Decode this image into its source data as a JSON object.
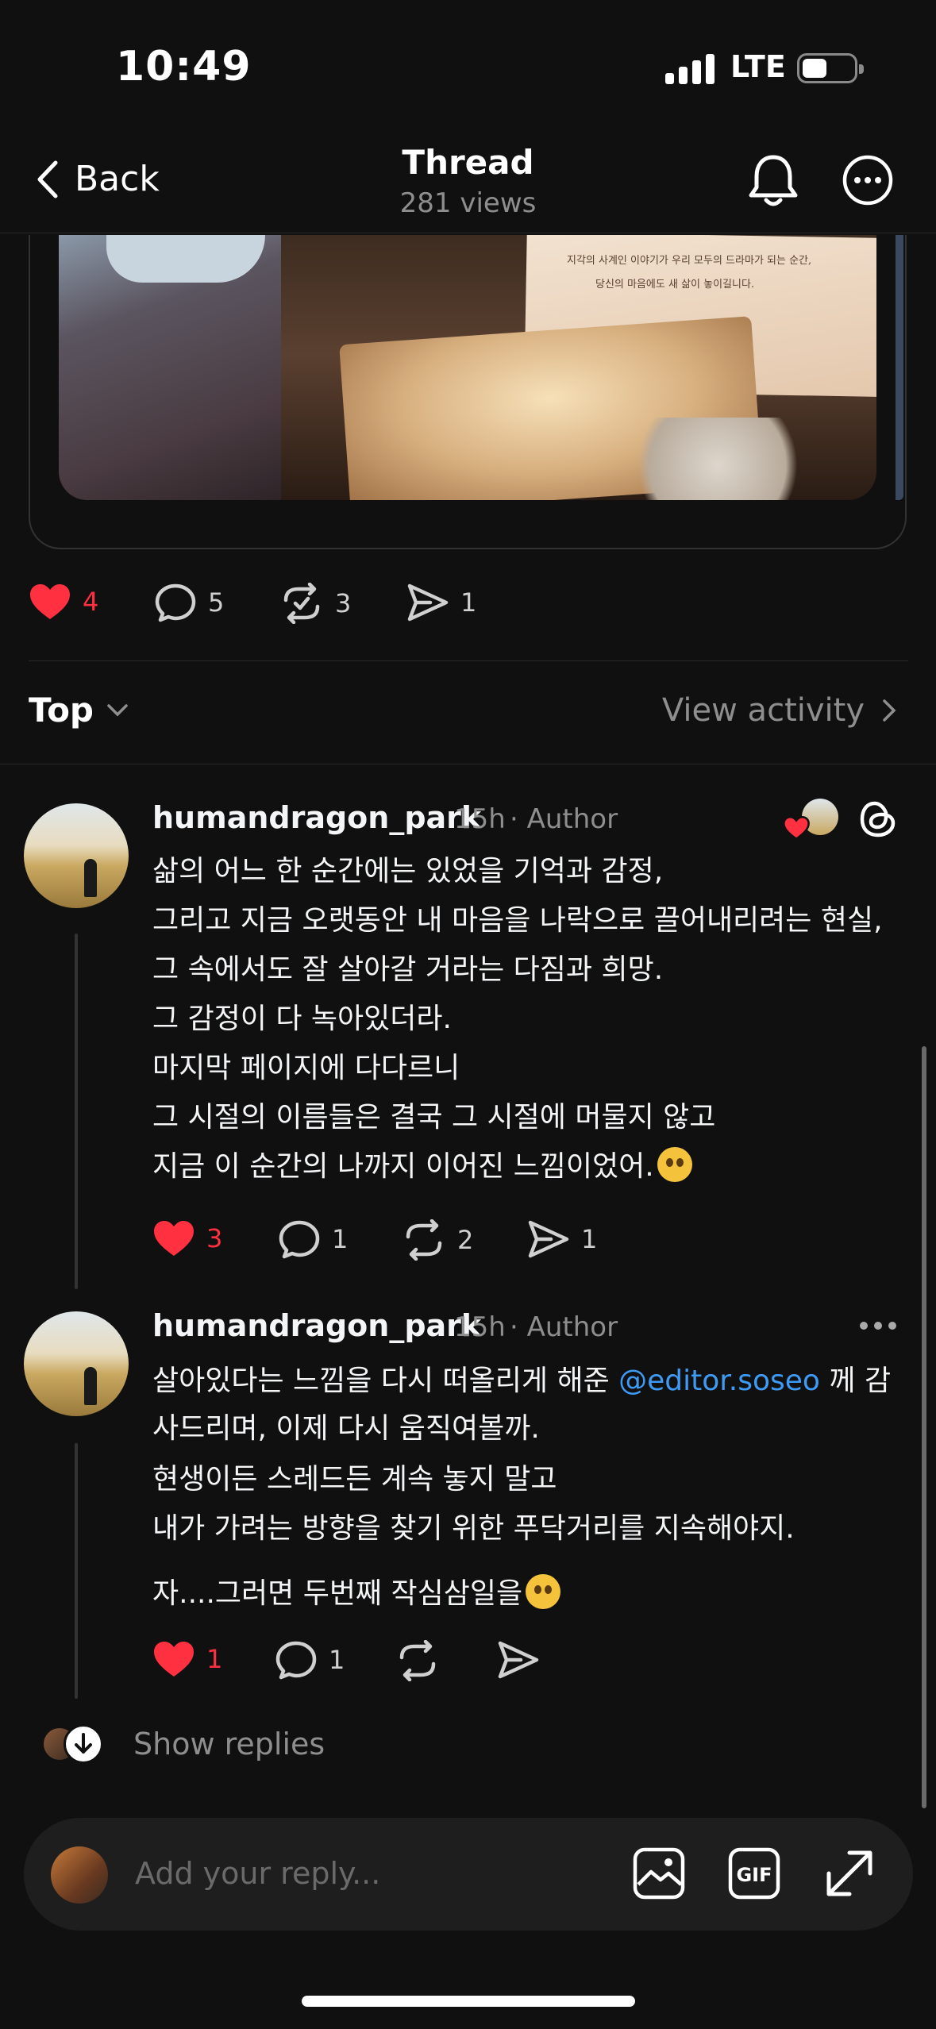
{
  "status_bar": {
    "time": "10:49",
    "network": "LTE"
  },
  "header": {
    "back_label": "Back",
    "title": "Thread",
    "views": "281 views"
  },
  "embedded_card_text": [
    "지각의 사계인 이야기가 우리 모두의 드라마가 되는 순간,",
    "당신의 마음에도 새 삶이 놓이길니다."
  ],
  "post_actions": {
    "likes": "4",
    "comments": "5",
    "reposts": "3",
    "shares": "1"
  },
  "sort": {
    "label": "Top",
    "view_activity": "View activity"
  },
  "replies": [
    {
      "username": "humandragon_park",
      "time": "15h",
      "role": "· Author",
      "lines": [
        "삶의 어느 한 순간에는 있었을 기억과 감정,",
        "그리고 지금 오랫동안 내 마음을 나락으로 끌어내리려는 현실,",
        "그 속에서도 잘 살아갈 거라는 다짐과 희망.",
        "그 감정이 다 녹아있더라.",
        "마지막 페이지에 다다르니",
        "그 시절의 이름들은 결국 그 시절에 머물지 않고",
        "지금 이 순간의 나까지 이어진 느낌이었어."
      ],
      "likes": "3",
      "comments": "1",
      "reposts": "2",
      "shares": "1"
    },
    {
      "username": "humandragon_park",
      "time": "15h",
      "role": "· Author",
      "line1_pre": "살아있다는 느낌을 다시 떠올리게 해준 ",
      "mention": "@editor.soseo",
      "line1_post": " 께 감",
      "lines": [
        "사드리며, 이제 다시 움직여볼까.",
        "현생이든 스레드든 계속 놓지 말고",
        "내가 가려는 방향을 찾기 위한 푸닥거리를 지속해야지.",
        "자....그러면 두번째 작심삼일을"
      ],
      "likes": "1",
      "comments": "1"
    }
  ],
  "show_replies": "Show replies",
  "composer": {
    "placeholder": "Add your reply..."
  },
  "colors": {
    "like": "#ff3040",
    "mention": "#3d9bf5",
    "background": "#101010"
  }
}
